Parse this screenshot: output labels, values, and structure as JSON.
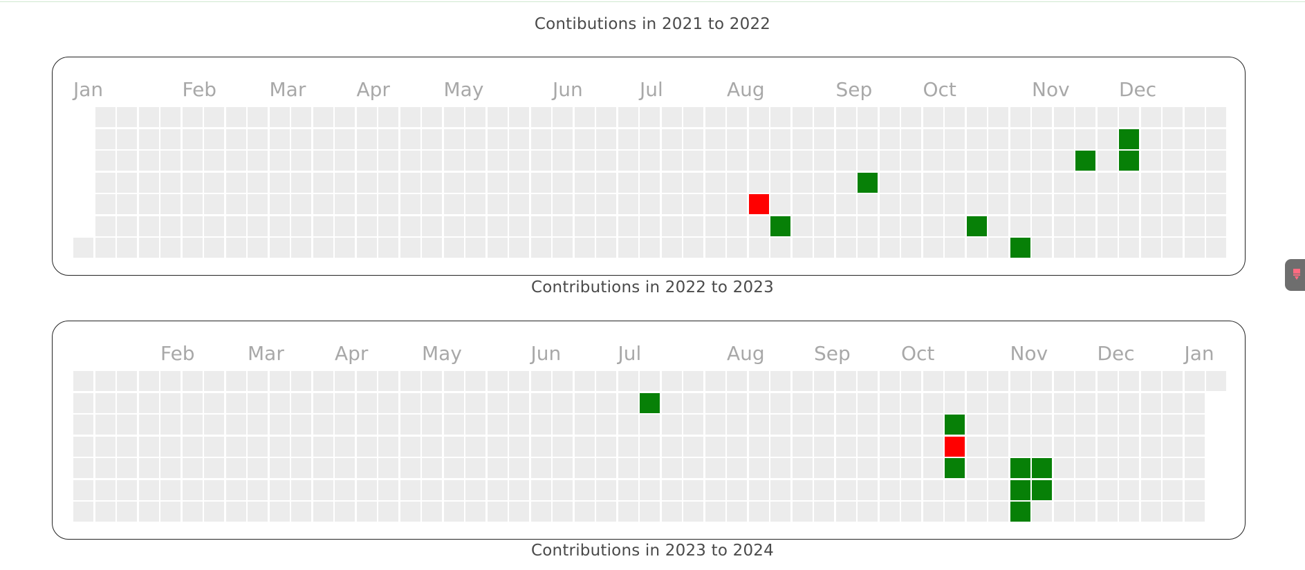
{
  "colors": {
    "empty": "#ececec",
    "green": "#078007",
    "red": "#ff0000"
  },
  "titles": {
    "chart_1": "Contibutions in 2021 to 2022",
    "chart_2": "Contributions in 2022 to 2023",
    "chart_3": "Contributions in 2023 to 2024"
  },
  "chart_data": [
    {
      "type": "heatmap",
      "title": "Contributions in 2022 to 2023",
      "month_labels": [
        "Jan",
        "Feb",
        "Mar",
        "Apr",
        "May",
        "Jun",
        "Jul",
        "Aug",
        "Sep",
        "Oct",
        "Nov",
        "Dec"
      ],
      "month_label_week": [
        0,
        5,
        9,
        13,
        17,
        22,
        26,
        30,
        35,
        39,
        44,
        48
      ],
      "weeks": 53,
      "days": 7,
      "first_week_days": [
        6
      ],
      "last_week_days": [
        0,
        1,
        2,
        3,
        4,
        5,
        6
      ],
      "highlights": [
        {
          "week": 31,
          "day": 4,
          "status": "red"
        },
        {
          "week": 32,
          "day": 5,
          "status": "green"
        },
        {
          "week": 36,
          "day": 3,
          "status": "green"
        },
        {
          "week": 41,
          "day": 5,
          "status": "green"
        },
        {
          "week": 43,
          "day": 6,
          "status": "green"
        },
        {
          "week": 46,
          "day": 2,
          "status": "green"
        },
        {
          "week": 48,
          "day": 1,
          "status": "green"
        },
        {
          "week": 48,
          "day": 2,
          "status": "green"
        }
      ]
    },
    {
      "type": "heatmap",
      "title": "Contributions in 2023 to 2024",
      "month_labels": [
        "Feb",
        "Mar",
        "Apr",
        "May",
        "Jun",
        "Jul",
        "Aug",
        "Sep",
        "Oct",
        "Nov",
        "Dec",
        "Jan"
      ],
      "month_label_week": [
        4,
        8,
        12,
        16,
        21,
        25,
        30,
        34,
        38,
        43,
        47,
        51
      ],
      "weeks": 53,
      "days": 7,
      "first_week_days": [
        0,
        1,
        2,
        3,
        4,
        5,
        6
      ],
      "last_week_days": [
        0
      ],
      "highlights": [
        {
          "week": 26,
          "day": 1,
          "status": "green"
        },
        {
          "week": 40,
          "day": 2,
          "status": "green"
        },
        {
          "week": 40,
          "day": 3,
          "status": "red"
        },
        {
          "week": 40,
          "day": 4,
          "status": "green"
        },
        {
          "week": 43,
          "day": 4,
          "status": "green"
        },
        {
          "week": 43,
          "day": 5,
          "status": "green"
        },
        {
          "week": 43,
          "day": 6,
          "status": "green"
        },
        {
          "week": 44,
          "day": 4,
          "status": "green"
        },
        {
          "week": 44,
          "day": 5,
          "status": "green"
        }
      ]
    }
  ]
}
